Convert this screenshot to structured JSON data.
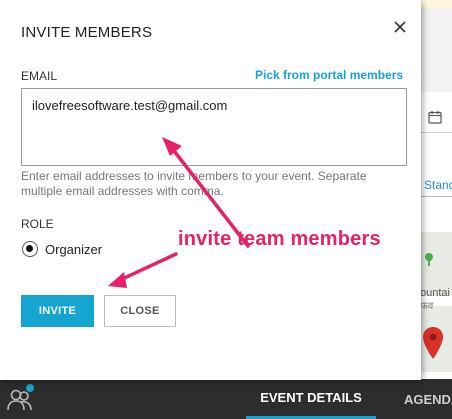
{
  "dialog": {
    "title": "INVITE MEMBERS",
    "close_icon": "close-icon",
    "email_label": "EMAIL",
    "pick_link": "Pick from portal members",
    "email_value": "ilovefreesoftware.test@gmail.com",
    "help_text": "Enter email addresses to invite members to your event. Separate multiple email addresses with comma.",
    "role_label": "ROLE",
    "role_option": "Organizer",
    "role_selected": true,
    "invite_button": "INVITE",
    "close_button": "CLOSE",
    "accent_color": "#16a4d1"
  },
  "background": {
    "side_link": "Stand",
    "map_label": "ountai",
    "map_sublabel": "फव",
    "calendar_icon": "calendar-icon",
    "map_pin_icon": "map-pin-icon"
  },
  "bottom_bar": {
    "people_icon": "people-icon",
    "tabs": [
      {
        "label": "EVENT DETAILS",
        "active": true
      },
      {
        "label": "AGENDA",
        "active": false
      }
    ]
  },
  "annotation": {
    "text": "invite team members",
    "color": "#e8206a"
  }
}
